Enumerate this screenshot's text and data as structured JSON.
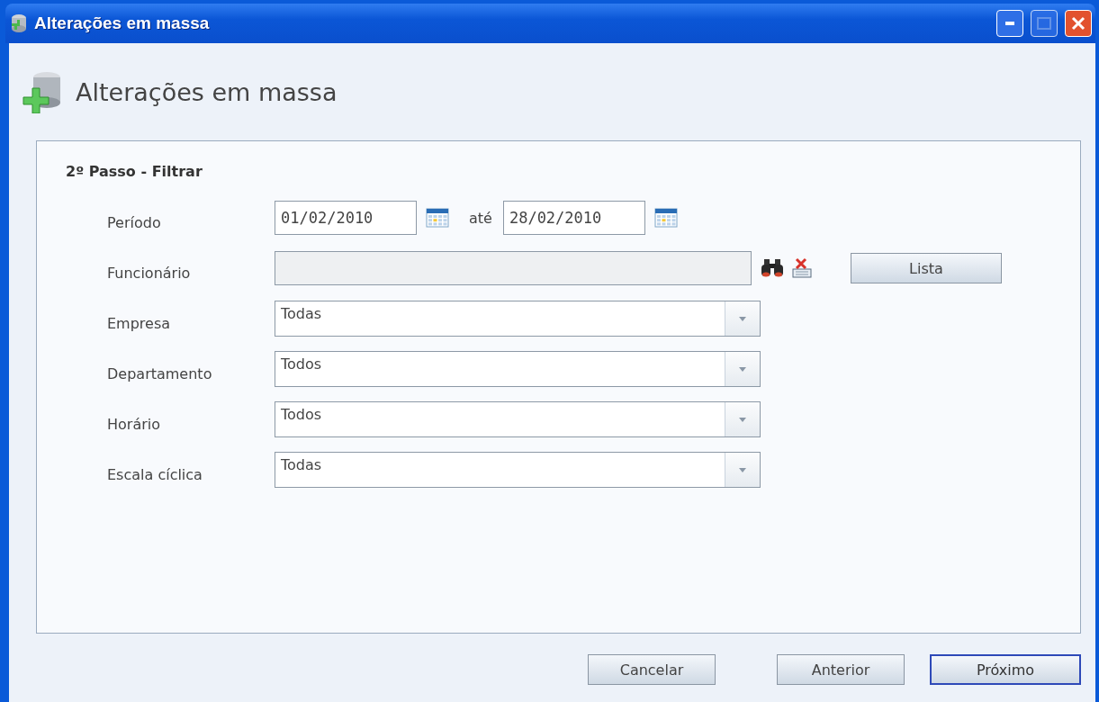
{
  "window": {
    "title": "Alterações em massa"
  },
  "heading": "Alterações em massa",
  "step_title": "2º Passo - Filtrar",
  "fields": [
    {
      "kind": "date_range",
      "label": "Período",
      "from": "01/02/2010",
      "separator": "até",
      "to": "28/02/2010"
    },
    {
      "kind": "lookup",
      "label": "Funcionário",
      "disabled": true,
      "button": "Lista"
    },
    {
      "kind": "select",
      "label": "Empresa",
      "value": "Todas"
    },
    {
      "kind": "select",
      "label": "Departamento",
      "value": "Todos"
    },
    {
      "kind": "select",
      "label": "Horário",
      "value": "Todos"
    },
    {
      "kind": "select",
      "label": "Escala cíclica",
      "value": "Todas"
    }
  ],
  "buttons": [
    {
      "label": "Cancelar",
      "default": false
    },
    {
      "label": "Anterior",
      "default": false
    },
    {
      "label": "Próximo",
      "default": true
    }
  ]
}
